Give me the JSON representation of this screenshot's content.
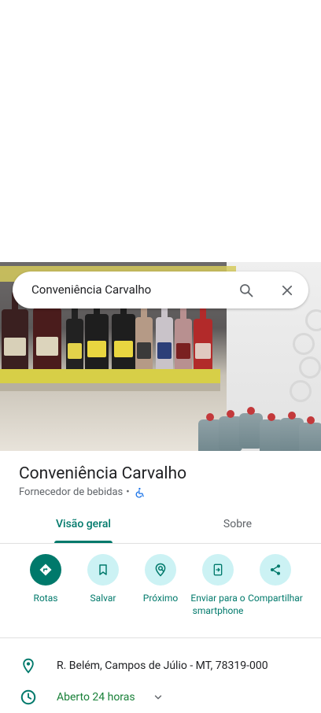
{
  "search": {
    "query": "Conveniência Carvalho"
  },
  "place": {
    "name": "Conveniência Carvalho",
    "category": "Fornecedor de bebidas",
    "separator": "•"
  },
  "tabs": [
    {
      "label": "Visão geral",
      "active": true
    },
    {
      "label": "Sobre",
      "active": false
    }
  ],
  "actions": [
    {
      "label": "Rotas",
      "icon": "directions-icon",
      "primary": true
    },
    {
      "label": "Salvar",
      "icon": "bookmark-icon",
      "primary": false
    },
    {
      "label": "Próximo",
      "icon": "nearby-icon",
      "primary": false
    },
    {
      "label": "Enviar para o smartphone",
      "icon": "send-to-phone-icon",
      "primary": false
    },
    {
      "label": "Compartilhar",
      "icon": "share-icon",
      "primary": false
    }
  ],
  "info": {
    "address": "R. Belém, Campos de Júlio - MT, 78319-000",
    "hours": "Aberto 24 horas"
  },
  "colors": {
    "accent": "#00796b",
    "action_bg": "#ccf2f4",
    "open_green": "#188038",
    "text_secondary": "#5f6368"
  }
}
